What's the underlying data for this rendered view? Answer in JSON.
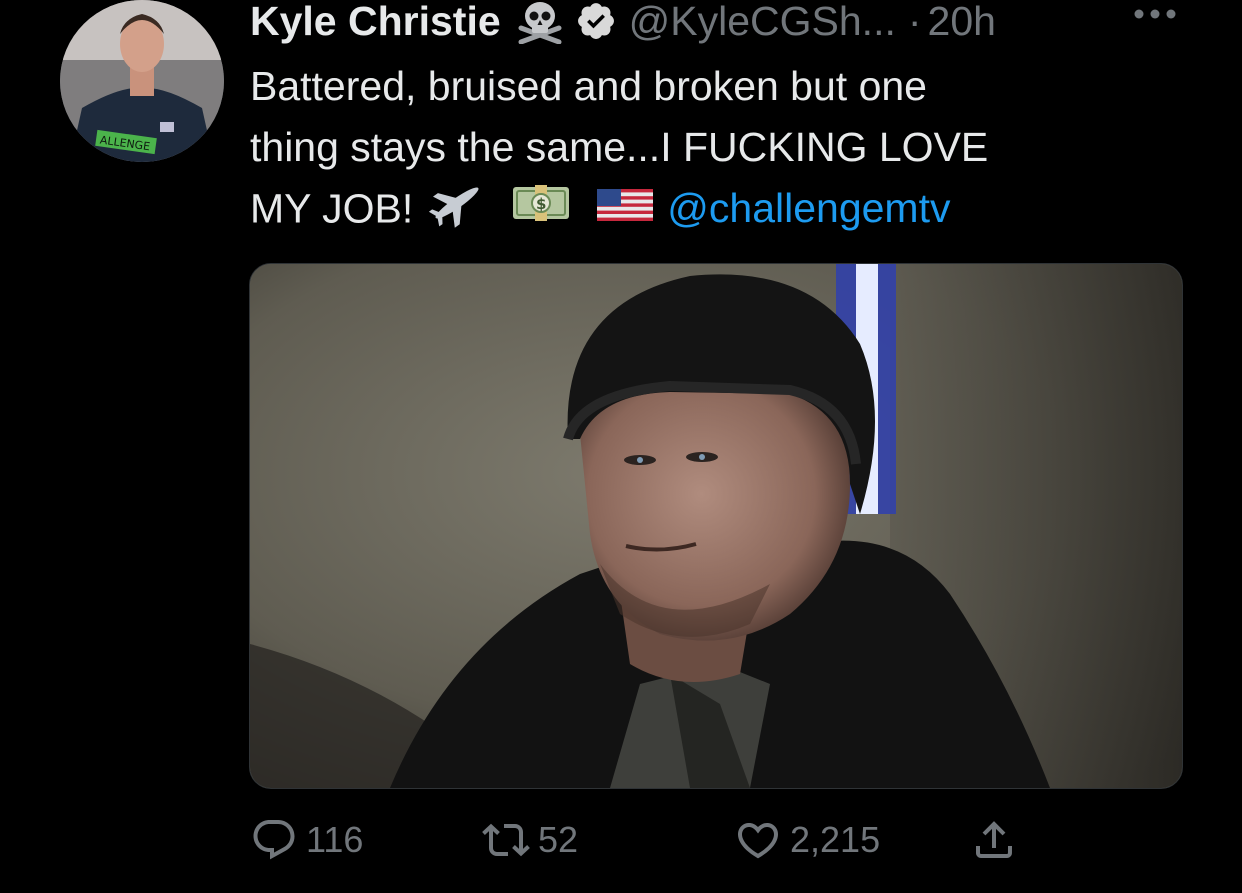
{
  "tweet": {
    "author": {
      "display_name": "Kyle Christie",
      "handle": "@KyleCGSh...",
      "verified": true,
      "name_emoji": "skull-crossbones-icon",
      "avatar_shirt_text": "ALLENGE"
    },
    "separator": "·",
    "timestamp": "20h",
    "text_lines": [
      "Battered, bruised and broken but one",
      "thing stays the same...I FUCKING LOVE",
      "MY JOB!"
    ],
    "text_emojis": [
      "airplane-icon",
      "money-bag-icon",
      "us-flag-icon"
    ],
    "mention": "@challengemtv",
    "stats": {
      "replies": "116",
      "retweets": "52",
      "likes": "2,215"
    }
  },
  "colors": {
    "background": "#000000",
    "text": "#e7e9ea",
    "secondary": "#71767b",
    "link": "#1d9bf0"
  }
}
